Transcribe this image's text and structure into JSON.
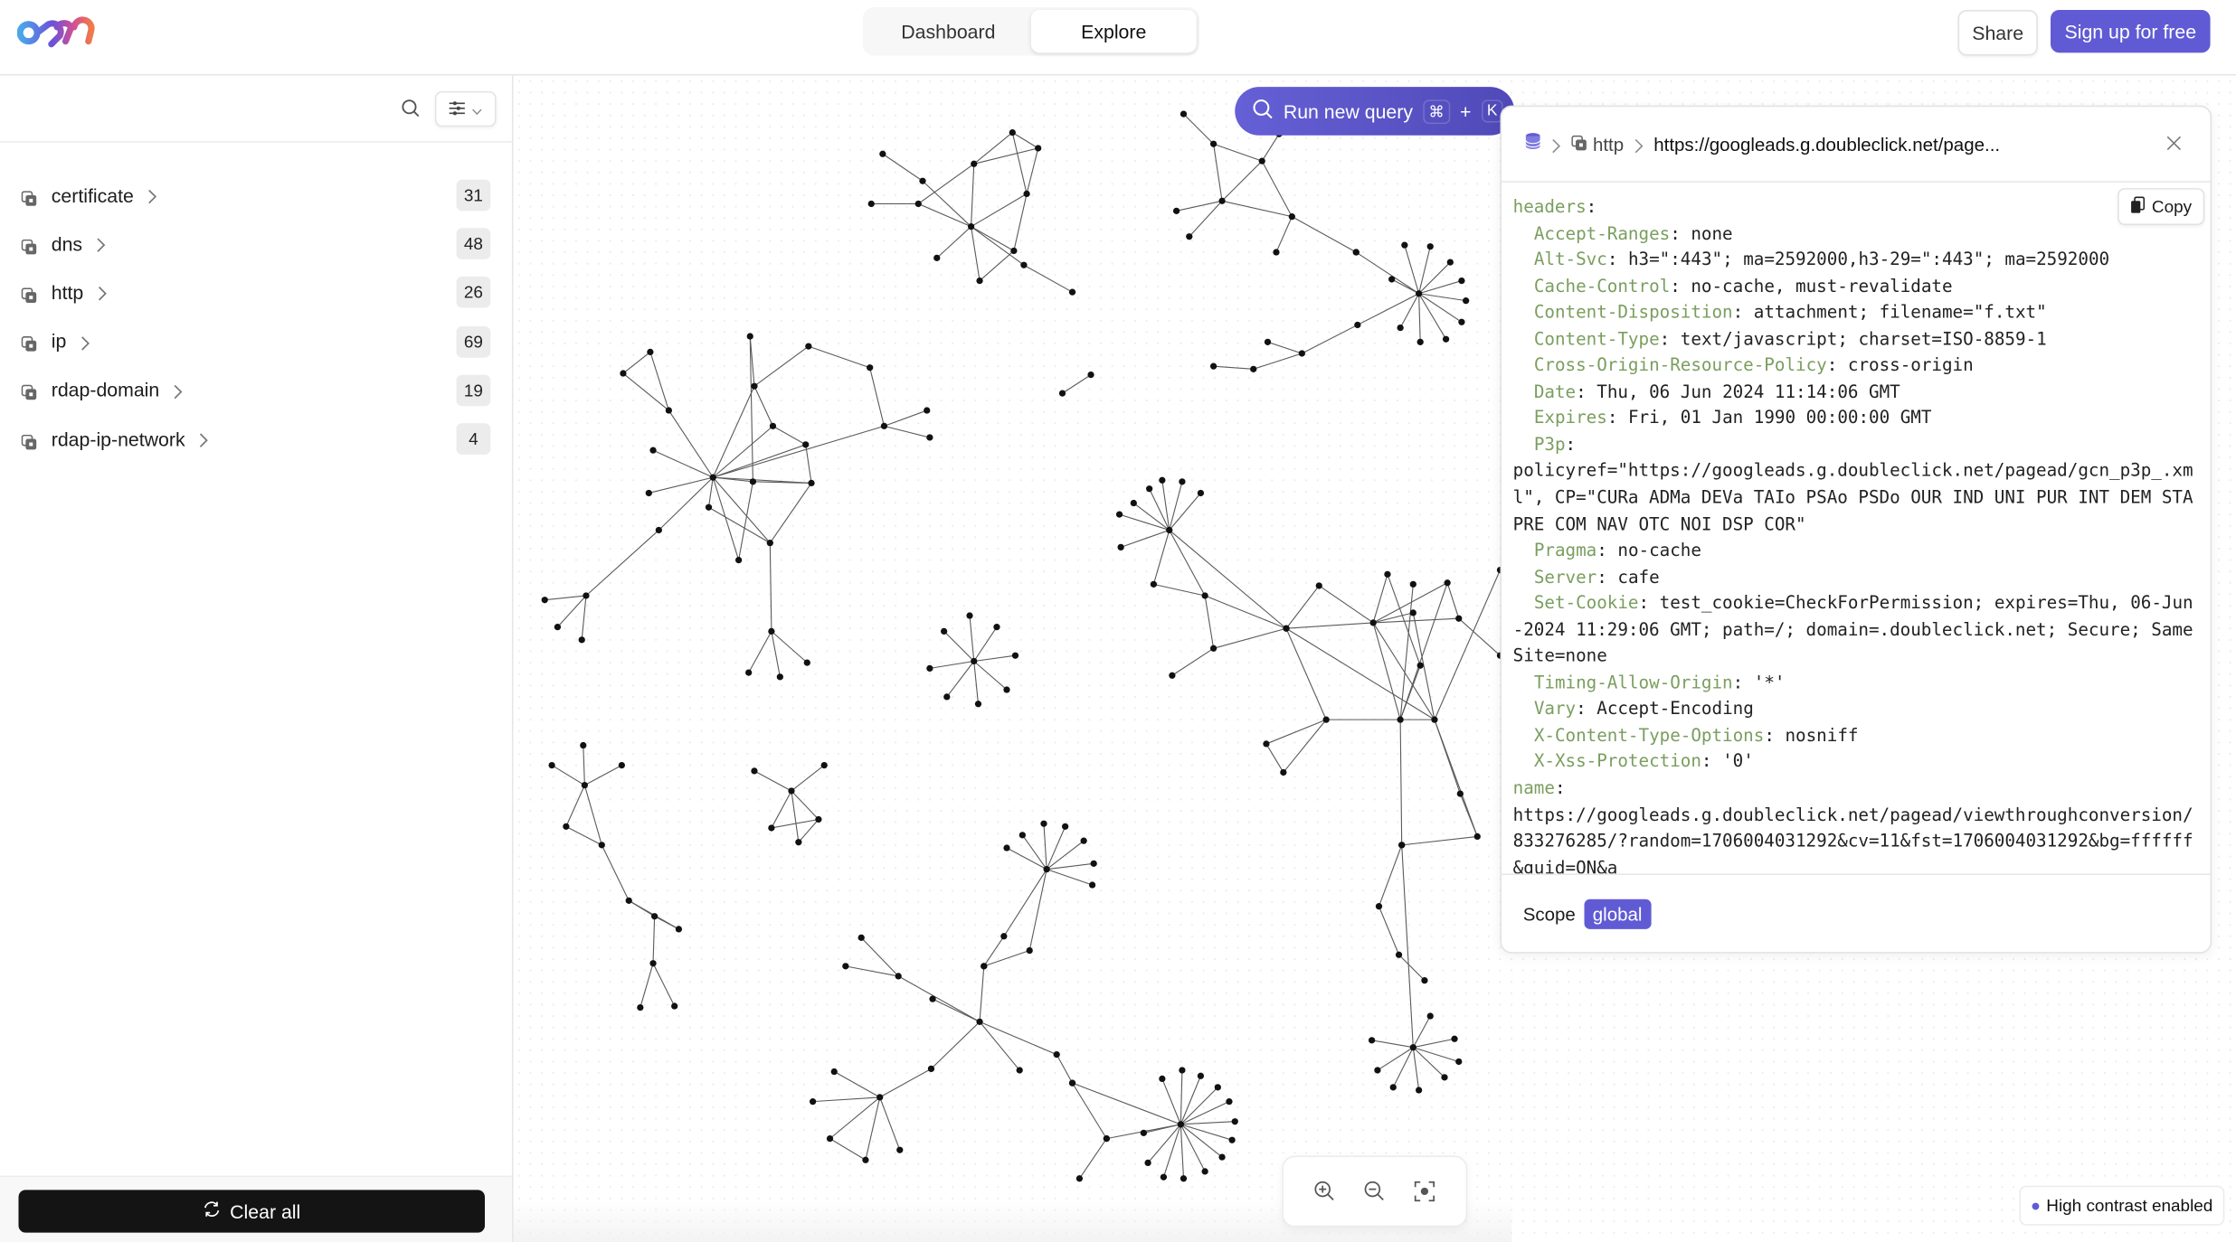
{
  "header": {
    "logo": "osm-logo",
    "tabs": [
      {
        "label": "Dashboard",
        "active": false
      },
      {
        "label": "Explore",
        "active": true
      }
    ],
    "share_label": "Share",
    "signup_label": "Sign up for free",
    "accent": "#605bd4"
  },
  "sidebar": {
    "search_icon": "search-icon",
    "filter_icon": "sliders-icon",
    "items": [
      {
        "label": "certificate",
        "count": "31"
      },
      {
        "label": "dns",
        "count": "48"
      },
      {
        "label": "http",
        "count": "26"
      },
      {
        "label": "ip",
        "count": "69"
      },
      {
        "label": "rdap-domain",
        "count": "19"
      },
      {
        "label": "rdap-ip-network",
        "count": "4"
      }
    ],
    "clear_label": "Clear all"
  },
  "query": {
    "label": "Run new query",
    "shortcut_mod": "⌘",
    "shortcut_plus": "+",
    "shortcut_key": "K"
  },
  "panel": {
    "breadcrumb": {
      "root_icon": "database-icon",
      "type": "http",
      "title": "https://googleads.g.doubleclick.net/page..."
    },
    "copy_label": "Copy",
    "key_color": "#7a9e5e",
    "record": [
      {
        "indent": 0,
        "key": "headers",
        "value": ""
      },
      {
        "indent": 1,
        "key": "Accept-Ranges",
        "value": "none"
      },
      {
        "indent": 1,
        "key": "Alt-Svc",
        "value": "h3=\":443\"; ma=2592000,h3-29=\":443\"; ma=2592000"
      },
      {
        "indent": 1,
        "key": "Cache-Control",
        "value": "no-cache, must-revalidate"
      },
      {
        "indent": 1,
        "key": "Content-Disposition",
        "value": "attachment; filename=\"f.txt\""
      },
      {
        "indent": 1,
        "key": "Content-Type",
        "value": "text/javascript; charset=ISO-8859-1"
      },
      {
        "indent": 1,
        "key": "Cross-Origin-Resource-Policy",
        "value": "cross-origin"
      },
      {
        "indent": 1,
        "key": "Date",
        "value": "Thu, 06 Jun 2024 11:14:06 GMT"
      },
      {
        "indent": 1,
        "key": "Expires",
        "value": "Fri, 01 Jan 1990 00:00:00 GMT"
      },
      {
        "indent": 1,
        "key": "P3p",
        "value": "\npolicyref=\"https://googleads.g.doubleclick.net/pagead/gcn_p3p_.xml\", CP=\"CURa ADMa DEVa TAIo PSAo PSDo OUR IND UNI PUR INT DEM STA PRE COM NAV OTC NOI DSP COR\""
      },
      {
        "indent": 1,
        "key": "Pragma",
        "value": "no-cache"
      },
      {
        "indent": 1,
        "key": "Server",
        "value": "cafe"
      },
      {
        "indent": 1,
        "key": "Set-Cookie",
        "value": "test_cookie=CheckForPermission; expires=Thu, 06-Jun-2024 11:29:06 GMT; path=/; domain=.doubleclick.net; Secure; SameSite=none"
      },
      {
        "indent": 1,
        "key": "Timing-Allow-Origin",
        "value": "'*'"
      },
      {
        "indent": 1,
        "key": "Vary",
        "value": "Accept-Encoding"
      },
      {
        "indent": 1,
        "key": "X-Content-Type-Options",
        "value": "nosniff"
      },
      {
        "indent": 1,
        "key": "X-Xss-Protection",
        "value": "'0'"
      },
      {
        "indent": 0,
        "key": "name",
        "value": "\nhttps://googleads.g.doubleclick.net/pagead/viewthroughconversion/833276285/?random=1706004031292&cv=11&fst=1706004031292&bg=ffffff&guid=ON&a"
      }
    ],
    "scope_label": "Scope",
    "scope_value": "global"
  },
  "zoom_controls": {
    "zoom_in": "zoom-in-icon",
    "zoom_out": "zoom-out-icon",
    "fit": "fit-view-icon"
  },
  "status": {
    "high_contrast_label": "High contrast enabled"
  }
}
